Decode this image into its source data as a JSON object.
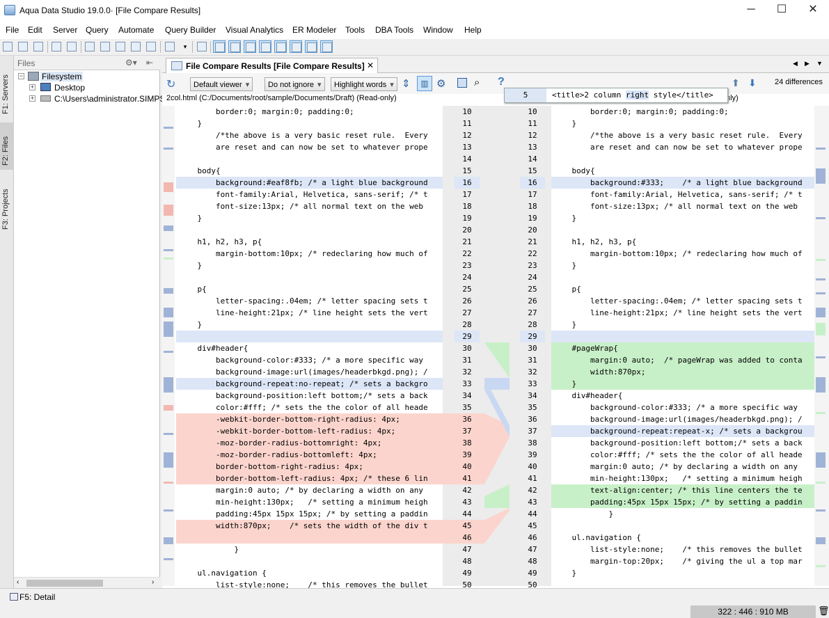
{
  "window": {
    "title": "Aqua Data Studio 19.0.0· [File Compare Results]"
  },
  "menu": [
    "File",
    "Edit",
    "Server",
    "Query",
    "Automate",
    "Query Builder",
    "Visual Analytics",
    "ER Modeler",
    "Tools",
    "DBA Tools",
    "Window",
    "Help"
  ],
  "sidetabs": {
    "servers": "F1: Servers",
    "files": "F2: Files",
    "projects": "F3: Projects"
  },
  "files": {
    "header": "Files",
    "root": "Filesystem",
    "desktop": "Desktop",
    "user": "C:\\Users\\administrator.SIMPSO"
  },
  "tab": {
    "label": "File Compare Results [File Compare Results]"
  },
  "compare": {
    "viewer": "Default viewer",
    "ignore": "Do not ignore",
    "highlight": "Highlight words",
    "differences": "24 differences",
    "path": "2col.html (C:/Documents/root/sample/Documents/Draft) (Read-only)",
    "right_suffix": "nly)"
  },
  "tooltip": {
    "line": "5",
    "pre": "<title>2 column ",
    "hl": "right",
    "post": " style</title>"
  },
  "rows": [
    {
      "l": "        border:0; margin:0; padding:0;",
      "ln": "10",
      "rn": "10",
      "r": "        border:0; margin:0; padding:0;"
    },
    {
      "l": "    }",
      "ln": "11",
      "rn": "11",
      "r": "    }"
    },
    {
      "l": "        /*the above is a very basic reset rule.  Every",
      "ln": "12",
      "rn": "12",
      "r": "        /*the above is a very basic reset rule.  Every"
    },
    {
      "l": "        are reset and can now be set to whatever prope",
      "ln": "13",
      "rn": "13",
      "r": "        are reset and can now be set to whatever prope"
    },
    {
      "l": "",
      "ln": "14",
      "rn": "14",
      "r": ""
    },
    {
      "l": "    body{",
      "ln": "15",
      "rn": "15",
      "r": "    body{"
    },
    {
      "l": "        background:#eaf8fb; /* a light blue background",
      "ln": "16",
      "rn": "16",
      "r": "        background:#333;    /* a light blue background",
      "t": "chg"
    },
    {
      "l": "        font-family:Arial, Helvetica, sans-serif; /* t",
      "ln": "17",
      "rn": "17",
      "r": "        font-family:Arial, Helvetica, sans-serif; /* t"
    },
    {
      "l": "        font-size:13px; /* all normal text on the web",
      "ln": "18",
      "rn": "18",
      "r": "        font-size:13px; /* all normal text on the web"
    },
    {
      "l": "    }",
      "ln": "19",
      "rn": "19",
      "r": "    }"
    },
    {
      "l": "",
      "ln": "20",
      "rn": "20",
      "r": ""
    },
    {
      "l": "    h1, h2, h3, p{",
      "ln": "21",
      "rn": "21",
      "r": "    h1, h2, h3, p{"
    },
    {
      "l": "        margin-bottom:10px; /* redeclaring how much of",
      "ln": "22",
      "rn": "22",
      "r": "        margin-bottom:10px; /* redeclaring how much of"
    },
    {
      "l": "    }",
      "ln": "23",
      "rn": "23",
      "r": "    }"
    },
    {
      "l": "",
      "ln": "24",
      "rn": "24",
      "r": ""
    },
    {
      "l": "    p{",
      "ln": "25",
      "rn": "25",
      "r": "    p{"
    },
    {
      "l": "        letter-spacing:.04em; /* letter spacing sets t",
      "ln": "26",
      "rn": "26",
      "r": "        letter-spacing:.04em; /* letter spacing sets t"
    },
    {
      "l": "        line-height:21px; /* line height sets the vert",
      "ln": "27",
      "rn": "27",
      "r": "        line-height:21px; /* line height sets the vert"
    },
    {
      "l": "    }",
      "ln": "28",
      "rn": "28",
      "r": "    }"
    },
    {
      "l": "",
      "ln": "29",
      "rn": "29",
      "r": "",
      "t": "cur"
    },
    {
      "l": "    div#header{",
      "ln": "30",
      "rn": "30",
      "r": "    #pageWrap{",
      "t": "addr"
    },
    {
      "l": "        background-color:#333; /* a more specific way",
      "ln": "31",
      "rn": "31",
      "r": "        margin:0 auto;  /* pageWrap was added to conta",
      "t": "addr"
    },
    {
      "l": "        background-image:url(images/headerbkgd.png); /",
      "ln": "32",
      "rn": "32",
      "r": "        width:870px;",
      "t": "addr"
    },
    {
      "l": "        background-repeat:no-repeat; /* sets a backgro",
      "ln": "33",
      "rn": "33",
      "r": "    }",
      "t": "chgl"
    },
    {
      "l": "        background-position:left bottom;/* sets a back",
      "ln": "34",
      "rn": "34",
      "r": "    div#header{"
    },
    {
      "l": "        color:#fff; /* sets the the color of all heade",
      "ln": "35",
      "rn": "35",
      "r": "        background-color:#333; /* a more specific way"
    },
    {
      "l": "        -webkit-border-bottom-right-radius: 4px;",
      "ln": "36",
      "rn": "36",
      "r": "        background-image:url(images/headerbkgd.png); /",
      "t": "dell"
    },
    {
      "l": "        -webkit-border-bottom-left-radius: 4px;",
      "ln": "37",
      "rn": "37",
      "r": "        background-repeat:repeat-x; /* sets a backgrou",
      "t": "dellchgr"
    },
    {
      "l": "        -moz-border-radius-bottomright: 4px;",
      "ln": "38",
      "rn": "38",
      "r": "        background-position:left bottom;/* sets a back",
      "t": "dell"
    },
    {
      "l": "        -moz-border-radius-bottomleft: 4px;",
      "ln": "39",
      "rn": "39",
      "r": "        color:#fff; /* sets the the color of all heade",
      "t": "dell"
    },
    {
      "l": "        border-bottom-right-radius: 4px;",
      "ln": "40",
      "rn": "40",
      "r": "        margin:0 auto; /* by declaring a width on any",
      "t": "dell"
    },
    {
      "l": "        border-bottom-left-radius: 4px; /* these 6 lin",
      "ln": "41",
      "rn": "41",
      "r": "        min-height:130px;   /* setting a minimum heigh",
      "t": "dell"
    },
    {
      "l": "        margin:0 auto; /* by declaring a width on any",
      "ln": "42",
      "rn": "42",
      "r": "        text-align:center; /* this line centers the te",
      "t": "addr"
    },
    {
      "l": "        min-height:130px;   /* setting a minimum heigh",
      "ln": "43",
      "rn": "43",
      "r": "        padding:45px 15px 15px; /* by setting a paddin",
      "t": "addr"
    },
    {
      "l": "        padding:45px 15px 15px; /* by setting a paddin",
      "ln": "44",
      "rn": "44",
      "r": "            }"
    },
    {
      "l": "        width:870px;    /* sets the width of the div t",
      "ln": "45",
      "rn": "45",
      "r": "",
      "t": "dell"
    },
    {
      "l": "",
      "ln": "46",
      "rn": "46",
      "r": "    ul.navigation {",
      "t": "dell"
    },
    {
      "l": "            }",
      "ln": "47",
      "rn": "47",
      "r": "        list-style:none;    /* this removes the bullet"
    },
    {
      "l": "",
      "ln": "48",
      "rn": "48",
      "r": "        margin-top:20px;    /* giving the ul a top mar"
    },
    {
      "l": "    ul.navigation {",
      "ln": "49",
      "rn": "49",
      "r": "    }"
    },
    {
      "l": "        list-style:none;    /* this removes the bullet",
      "ln": "50",
      "rn": "50",
      "r": ""
    }
  ],
  "statusbar": {
    "detail": "F5: Detail",
    "memory": "322 : 446 : 910 MB"
  },
  "colors": {
    "changed": "#dce6f7",
    "deleted": "#fbd5cd",
    "added": "#c8f0c8",
    "gutter": "#ececec"
  }
}
